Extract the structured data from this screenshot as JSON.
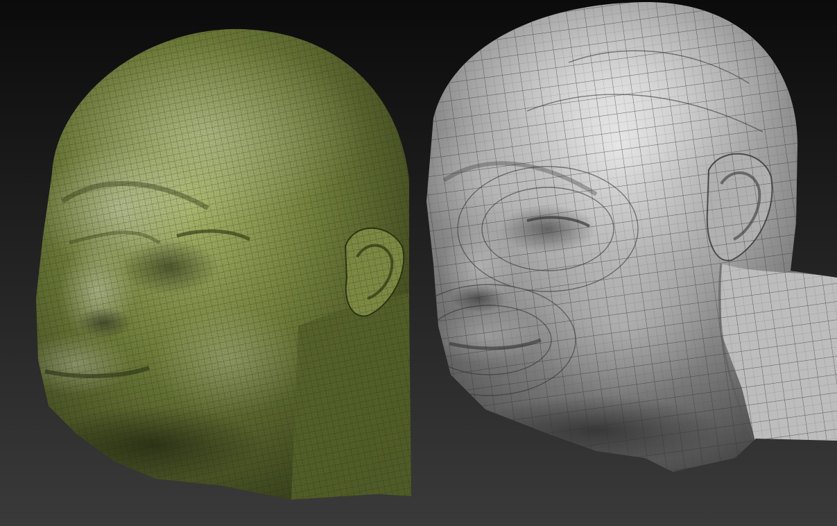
{
  "scene": {
    "background": {
      "top_color": "#0b0b0b",
      "bottom_color": "#3a3a3a"
    },
    "left_model": {
      "subject": "sculpted-head",
      "material_color": "#6f7d3a",
      "material_highlight": "#a8b56a",
      "material_shadow": "#2f3716",
      "wireframe": "dense"
    },
    "right_model": {
      "subject": "sculpted-head",
      "material_color": "#9a9a9a",
      "material_highlight": "#e2e2e2",
      "material_shadow": "#3e3e3e",
      "wireframe": "quad-topology"
    }
  }
}
